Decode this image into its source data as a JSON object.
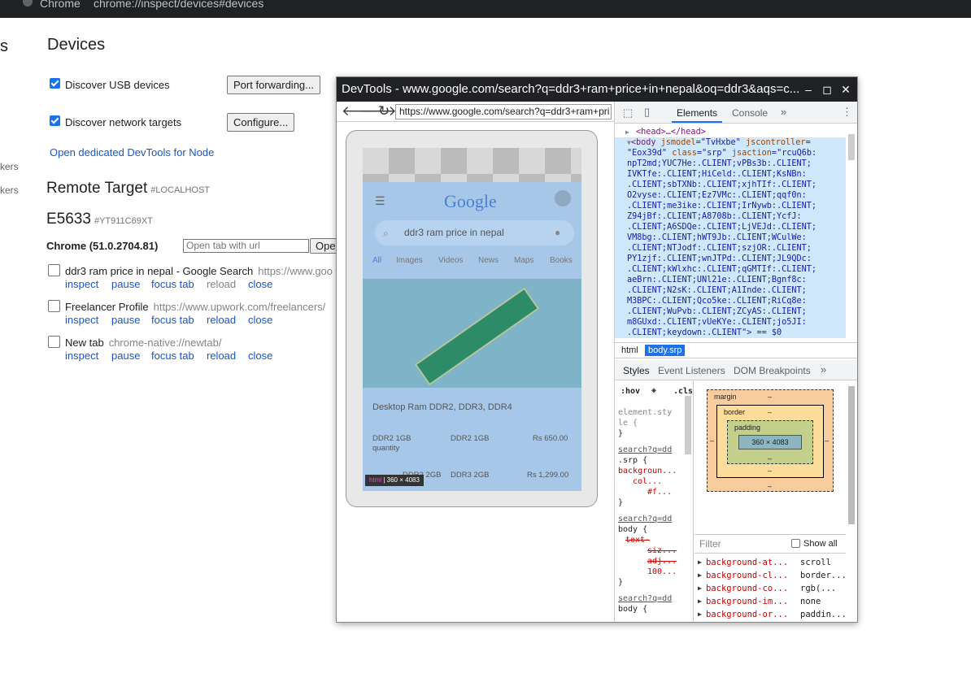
{
  "topbar": {
    "app": "Chrome",
    "url": "chrome://inspect/devices#devices"
  },
  "left_cut": [
    "s",
    "kers",
    "kers"
  ],
  "devices": {
    "title": "Devices",
    "discover_usb": "Discover USB devices",
    "port_forwarding": "Port forwarding...",
    "discover_network": "Discover network targets",
    "configure": "Configure...",
    "open_devtools_node": "Open dedicated DevTools for Node"
  },
  "remote": {
    "title": "Remote Target",
    "host": "#LOCALHOST",
    "device": "E5633",
    "device_id": "#YT911C69XT",
    "browser": "Chrome (51.0.2704.81)",
    "url_placeholder": "Open tab with url",
    "open_btn": "Ope"
  },
  "pages": [
    {
      "title": "ddr3 ram price in nepal - Google Search",
      "url": "https://www.goo",
      "actions": [
        "inspect",
        "pause",
        "focus tab",
        "reload",
        "close"
      ]
    },
    {
      "title": "Freelancer Profile",
      "url": "https://www.upwork.com/freelancers/",
      "actions": [
        "inspect",
        "pause",
        "focus tab",
        "reload",
        "close"
      ]
    },
    {
      "title": "New tab",
      "url": "chrome-native://newtab/",
      "actions": [
        "inspect",
        "pause",
        "focus tab",
        "reload",
        "close"
      ]
    }
  ],
  "devtools": {
    "window_title": "DevTools - www.google.com/search?q=ddr3+ram+price+in+nepal&oq=ddr3&aqs=c...",
    "url": "https://www.google.com/search?q=ddr3+ram+pri",
    "screencast": {
      "logo": "Google",
      "search": "ddr3 ram price in nepal",
      "tabs": [
        "All",
        "Images",
        "Videos",
        "News",
        "Maps",
        "Books"
      ],
      "result_title": "Desktop Ram DDR2, DDR3, DDR4",
      "row1": [
        "DDR2 1GB",
        "quantity",
        "DDR2 1GB",
        "Rs 650.00"
      ],
      "row2": [
        "DDR3 2GB",
        "DDR3 2GB",
        "Rs 1,299.00"
      ],
      "tooltip_tag": "html",
      "tooltip_size": "360 × 4083"
    },
    "tabs": [
      "Elements",
      "Console",
      "»"
    ],
    "head_line": "<head>…</head>",
    "body_open": {
      "tag": "body",
      "attrs": [
        [
          "jsmodel",
          "\"TvHxbe\""
        ],
        [
          "jscontroller",
          "\"Eox39d\""
        ],
        [
          "class",
          "\"srp\""
        ],
        [
          "jsaction",
          "\"rcuQ6b:"
        ]
      ]
    },
    "body_lines": [
      "npT2md;YUC7He:.CLIENT;vPBs3b:.CLIENT;",
      "IVKTfe:.CLIENT;HiCeld:.CLIENT;KsNBn:",
      ".CLIENT;sbTXNb:.CLIENT;xjhTIf:.CLIENT;",
      "O2vyse:.CLIENT;Ez7VMc:.CLIENT;qqf0n:",
      ".CLIENT;me3ike:.CLIENT;IrNywb:.CLIENT;",
      "Z94jBf:.CLIENT;A8708b:.CLIENT;YcfJ:",
      ".CLIENT;A6SDQe:.CLIENT;LjVEJd:.CLIENT;",
      "VM8bg:.CLIENT;hWT9Jb:.CLIENT;WCulWe:",
      ".CLIENT;NTJodf:.CLIENT;szjOR:.CLIENT;",
      "PY1zjf:.CLIENT;wnJTPd:.CLIENT;JL9QDc:",
      ".CLIENT;kWlxhc:.CLIENT;qGMTIf:.CLIENT;",
      "aeBrn:.CLIENT;UNl21e:.CLIENT;Bgnf8c:",
      ".CLIENT;N2sK:.CLIENT;A1Inde:.CLIENT;",
      "M3BPC:.CLIENT;Qco5ke:.CLIENT;RiCq8e:",
      ".CLIENT;WuPvb:.CLIENT;ZCyAS:.CLIENT;",
      "m8GUxd:.CLIENT;vUeKYe:.CLIENT;jo5JI:"
    ],
    "body_last": ".CLIENT;keydown:.CLIENT\"> == $0",
    "crumbs": [
      "html",
      "body.srp"
    ],
    "style_tabs": [
      "Styles",
      "Event Listeners",
      "DOM Breakpoints",
      "»"
    ],
    "hov": ":hov",
    "cls": ".cls",
    "styles_lines": [
      "element.sty",
      "le {",
      "}",
      "search?q=dd",
      ".srp {",
      "",
      "backgroun...",
      "col...",
      "#f...",
      "}",
      "search?q=dd",
      "body {",
      "text-",
      "siz...",
      "adj...",
      "100...",
      "}",
      "search?q=dd",
      "body {"
    ],
    "box": {
      "margin": "margin",
      "border": "border",
      "padding": "padding",
      "content": "360 × 4083",
      "dash": "–"
    },
    "filter": "Filter",
    "show_all": "Show all",
    "computed": [
      [
        "background-at...",
        "scroll"
      ],
      [
        "background-cl...",
        "border..."
      ],
      [
        "background-co...",
        "rgb(..."
      ],
      [
        "background-im...",
        "none"
      ],
      [
        "background-or...",
        "paddin..."
      ]
    ]
  }
}
